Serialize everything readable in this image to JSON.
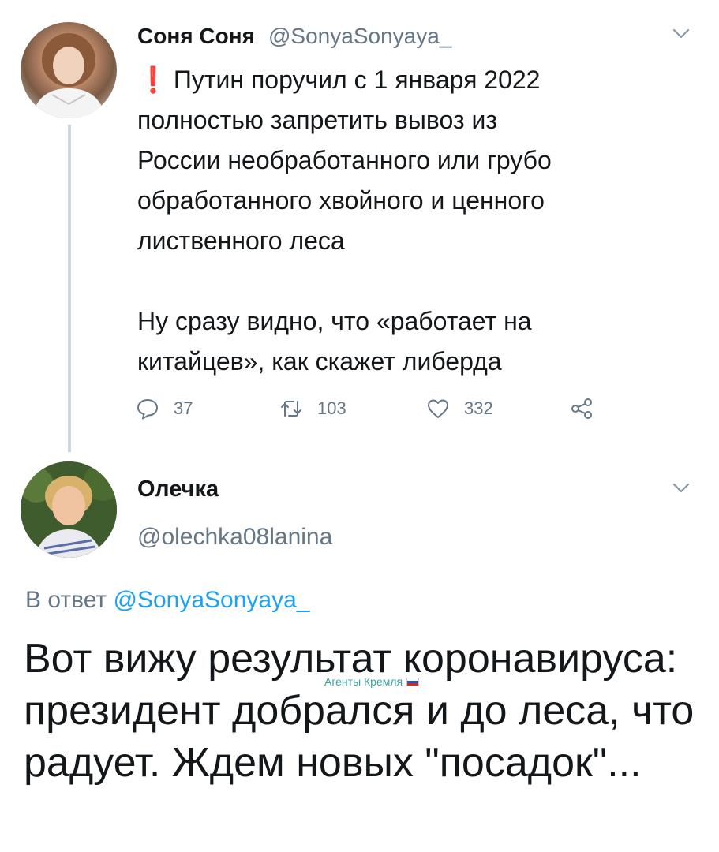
{
  "tweet1": {
    "display_name": "Соня Соня",
    "handle": "@SonyaSonyaya_",
    "text_line1": "Путин поручил с 1 января 2022",
    "text_rest": "полностью запретить вывоз из\nРоссии необработанного или грубо\nобработанного хвойного и ценного\nлиственного леса\n\nНу сразу видно, что «работает на\nкитайцев», как скажет либерда",
    "reply_count": "37",
    "retweet_count": "103",
    "like_count": "332"
  },
  "tweet2": {
    "display_name": "Олечка",
    "handle": "@olechka08lanina",
    "reply_prefix": "В ответ ",
    "reply_handle": "@SonyaSonyaya_",
    "text": "Вот вижу результат коронавируса: президент добрался и до леса, что радует. Ждем новых \"посадок\"..."
  },
  "watermark": {
    "text": "Агенты Кремля"
  },
  "icons": {
    "reply": "speech-bubble-icon",
    "retweet": "retweet-icon",
    "like": "heart-icon",
    "share": "share-icon",
    "menu": "chevron-down-icon",
    "alert": "exclamation-icon"
  },
  "colors": {
    "text": "#14171a",
    "secondary": "#657786",
    "link": "#1da1f2",
    "thread_line": "#ccd6dd",
    "exclamation": "#dd2e44"
  }
}
